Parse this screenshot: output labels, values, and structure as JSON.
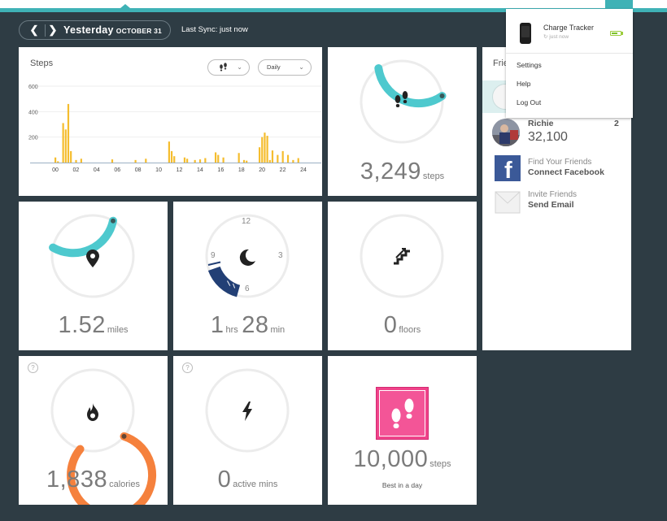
{
  "header": {
    "date_title": "Yesterday",
    "date_sub": "OCTOBER 31",
    "last_sync": "Last Sync: just now",
    "prev_icon": "chevron-left-icon",
    "next_icon": "chevron-right-icon"
  },
  "steps_chart": {
    "title": "Steps",
    "metric_icon": "footprints-icon",
    "period_label": "Daily"
  },
  "chart_data": {
    "type": "bar",
    "title": "Steps",
    "xlabel": "",
    "ylabel": "",
    "ylim": [
      0,
      600
    ],
    "yticks": [
      "600",
      "400",
      "200"
    ],
    "xticks": [
      "00",
      "02",
      "04",
      "06",
      "08",
      "10",
      "12",
      "14",
      "16",
      "18",
      "20",
      "22",
      "24"
    ],
    "bar_color": "#f5bd2e",
    "x": [
      0.0,
      0.25,
      0.75,
      1.0,
      1.25,
      1.5,
      2.0,
      2.5,
      5.5,
      7.75,
      8.75,
      11.0,
      11.25,
      11.5,
      12.5,
      12.75,
      13.5,
      14.0,
      14.5,
      15.5,
      15.75,
      16.25,
      17.75,
      18.25,
      18.5,
      19.75,
      20.0,
      20.25,
      20.5,
      20.75,
      21.0,
      21.5,
      22.0,
      22.5,
      23.0,
      23.5
    ],
    "values": [
      40,
      10,
      310,
      260,
      460,
      90,
      20,
      30,
      25,
      20,
      30,
      165,
      90,
      50,
      40,
      30,
      20,
      25,
      35,
      80,
      60,
      40,
      75,
      20,
      15,
      120,
      200,
      235,
      210,
      20,
      95,
      60,
      90,
      60,
      20,
      35
    ]
  },
  "tiles": {
    "steps": {
      "value": "3,249",
      "unit": "steps",
      "progress": 0.325,
      "icon": "footprints-icon",
      "color": "#4ec9ce"
    },
    "distance": {
      "value": "1.52",
      "unit": "miles",
      "progress": 0.3,
      "icon": "location-pin-icon",
      "color": "#4ec9ce"
    },
    "sleep": {
      "hours": "1",
      "hours_unit": "hrs",
      "minutes": "28",
      "minutes_unit": "min",
      "clock": [
        "12",
        "3",
        "6",
        "9"
      ],
      "icon": "moon-icon",
      "color": "#223f75"
    },
    "floors": {
      "value": "0",
      "unit": "floors",
      "progress": 0,
      "icon": "stairs-icon"
    },
    "calories": {
      "value": "1,838",
      "unit": "calories",
      "progress": 0.81,
      "icon": "flame-icon",
      "color": "#f5813d",
      "help": "?"
    },
    "active": {
      "value": "0",
      "unit": "active mins",
      "progress": 0,
      "icon": "lightning-icon",
      "help": "?"
    },
    "best": {
      "value": "10,000",
      "unit": "steps",
      "caption": "Best in a day",
      "icon": "footprints-badge-icon",
      "color": "#f0438a"
    }
  },
  "friends": {
    "heading": "Frie",
    "entries": [
      {
        "name": "Richie",
        "steps": "32,100",
        "rank": "2"
      }
    ],
    "facebook": {
      "line1": "Find Your Friends",
      "line2": "Connect Facebook"
    },
    "invite": {
      "line1": "Invite Friends",
      "line2": "Send Email"
    }
  },
  "dropdown": {
    "device_name": "Charge Tracker",
    "device_sync": "just now",
    "battery_level": 0.7,
    "items": [
      "Settings",
      "Help",
      "Log Out"
    ]
  }
}
